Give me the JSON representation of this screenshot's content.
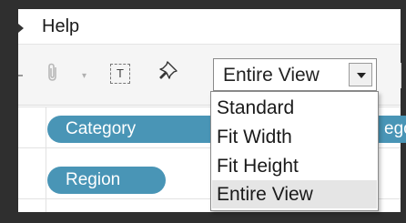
{
  "menubar": {
    "help_label": "Help"
  },
  "toolbar": {
    "text_icon_glyph": "T",
    "fit_combo": {
      "selected": "Entire View"
    }
  },
  "shelves": {
    "rows_pill": "Category",
    "cols_pill": "Region",
    "partial_pill": "ego"
  },
  "fit_dropdown": {
    "options": [
      "Standard",
      "Fit Width",
      "Fit Height",
      "Entire View"
    ],
    "highlighted_index": 3
  },
  "colors": {
    "pill": "#4995b6",
    "highlight": "#e5e5e5",
    "frame": "#2f2f2f"
  }
}
